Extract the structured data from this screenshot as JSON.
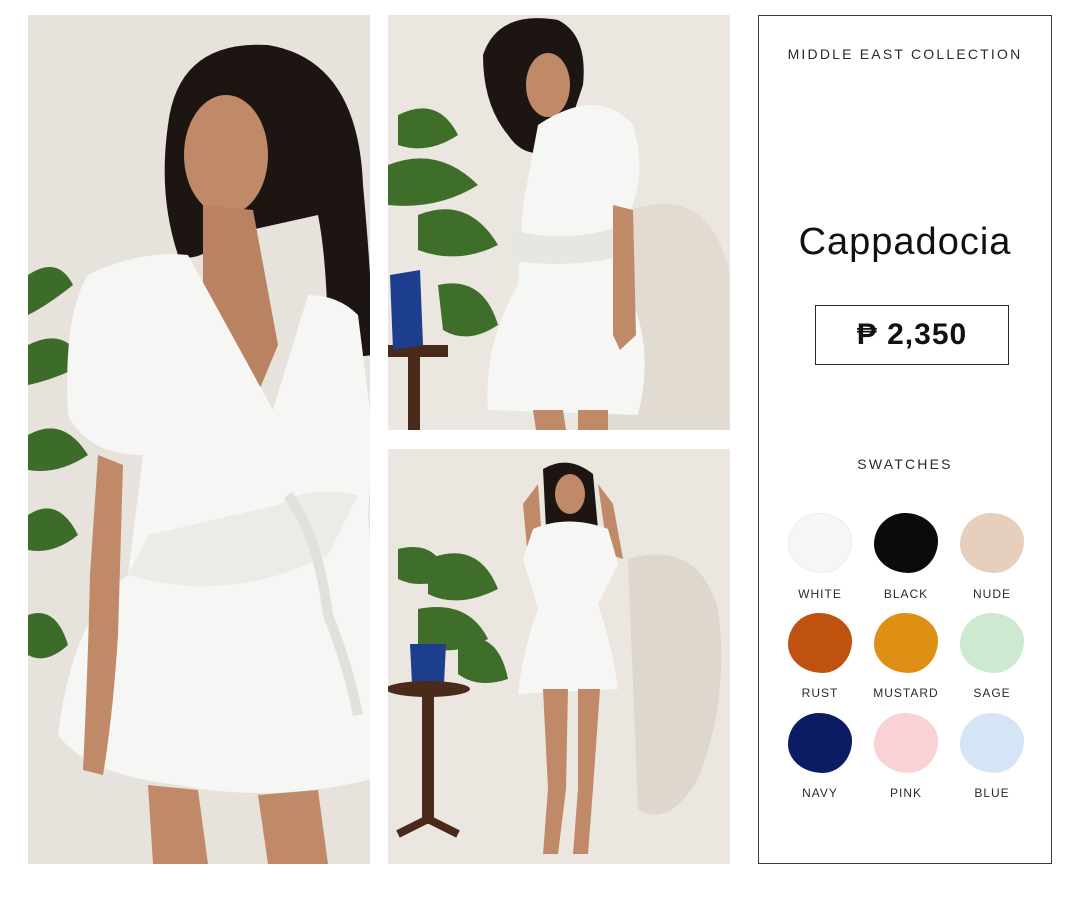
{
  "panel": {
    "collection": "MIDDLE EAST COLLECTION",
    "title": "Cappadocia",
    "price": "₱ 2,350",
    "swatch_heading": "SWATCHES",
    "swatches": [
      {
        "name": "WHITE",
        "color": "#f7f6f5"
      },
      {
        "name": "BLACK",
        "color": "#0b0b0b"
      },
      {
        "name": "NUDE",
        "color": "#e6cfbd"
      },
      {
        "name": "RUST",
        "color": "#c0520f"
      },
      {
        "name": "MUSTARD",
        "color": "#de9015"
      },
      {
        "name": "SAGE",
        "color": "#cde9cf"
      },
      {
        "name": "NAVY",
        "color": "#0c1c63"
      },
      {
        "name": "PINK",
        "color": "#fad1d5"
      },
      {
        "name": "BLUE",
        "color": "#d5e5f6"
      }
    ]
  },
  "photos": [
    {
      "id": "main",
      "subject": "model in white wrap dress, portrait close-up"
    },
    {
      "id": "side",
      "subject": "model in white wrap dress, side view"
    },
    {
      "id": "full",
      "subject": "model in white wrap dress, full length"
    }
  ]
}
